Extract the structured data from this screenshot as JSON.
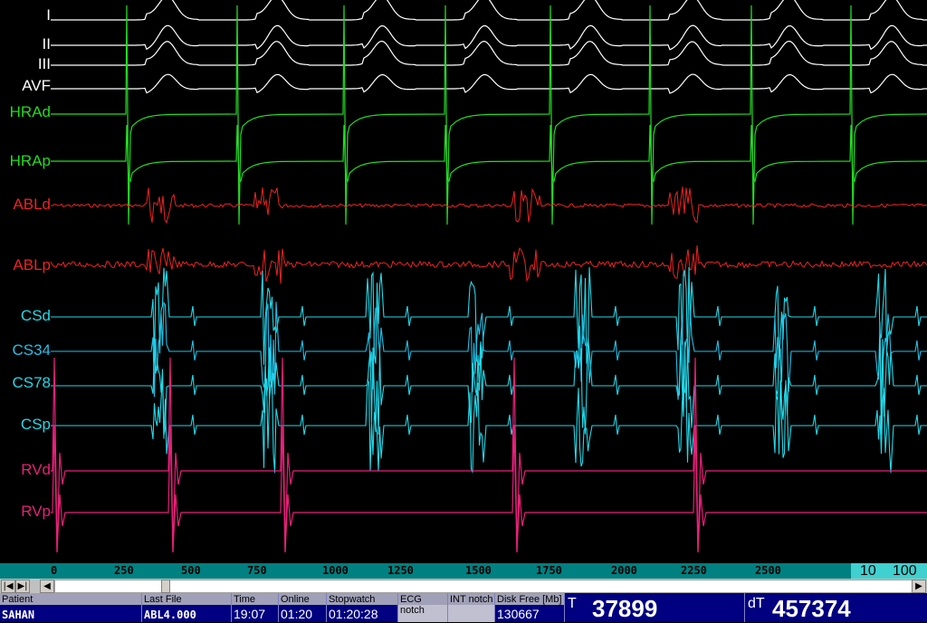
{
  "channels": [
    {
      "label": "I",
      "color": "#ffffff"
    },
    {
      "label": "II",
      "color": "#ffffff"
    },
    {
      "label": "III",
      "color": "#ffffff"
    },
    {
      "label": "AVF",
      "color": "#ffffff"
    },
    {
      "label": "HRAd",
      "color": "#22dd22"
    },
    {
      "label": "HRAp",
      "color": "#22dd22"
    },
    {
      "label": "ABLd",
      "color": "#ee2222"
    },
    {
      "label": "ABLp",
      "color": "#ee2222"
    },
    {
      "label": "CSd",
      "color": "#22d8e8"
    },
    {
      "label": "CS34",
      "color": "#22c0e8"
    },
    {
      "label": "CS78",
      "color": "#22d8e8"
    },
    {
      "label": "CSp",
      "color": "#22d8e8"
    },
    {
      "label": "RVd",
      "color": "#e8207a"
    },
    {
      "label": "RVp",
      "color": "#e8207a"
    }
  ],
  "time_axis": {
    "ticks": [
      "0",
      "250",
      "500",
      "750",
      "1000",
      "1250",
      "1500",
      "1750",
      "2000",
      "2250",
      "2500"
    ],
    "scale_a": "10",
    "scale_b": "100"
  },
  "status": {
    "patient_label": "Patient",
    "patient": "SAHAN",
    "lastfile_label": "Last File",
    "lastfile": "ABL4.000",
    "time_label": "Time",
    "time": "19:07",
    "online_label": "Online",
    "online": "01:20",
    "stopwatch_label": "Stopwatch",
    "stopwatch": "01:20:28",
    "ecg_notch_label": "ECG notch",
    "int_notch_label": "INT notch",
    "disk_free_label": "Disk Free [Mb]",
    "disk_free": "130667",
    "t_label": "T",
    "t_value": "37899",
    "dt_label": "dT",
    "dt_value": "457374"
  },
  "icons": [
    "scroll-left-end-icon",
    "scroll-right-end-icon",
    "scroll-left-icon",
    "scroll-right-icon"
  ]
}
